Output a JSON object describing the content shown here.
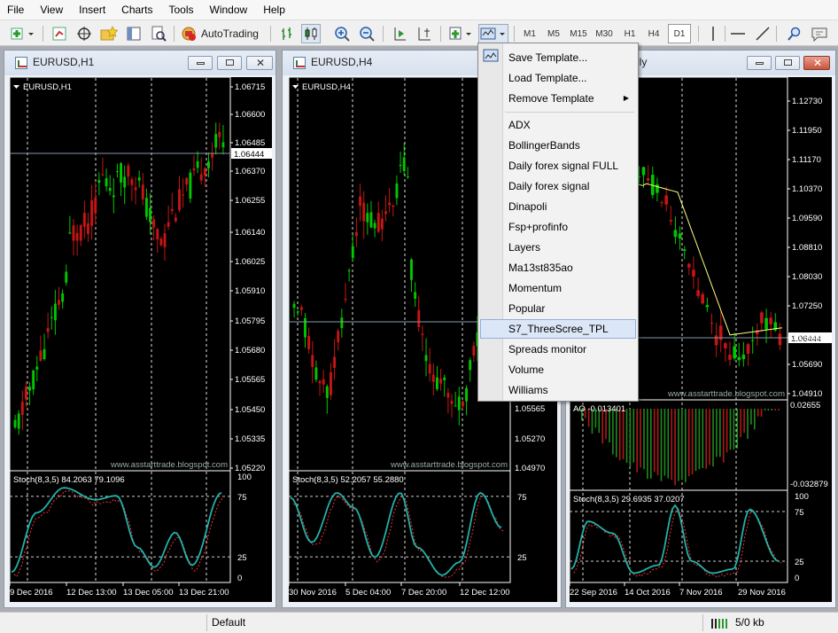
{
  "menu": [
    "File",
    "View",
    "Insert",
    "Charts",
    "Tools",
    "Window",
    "Help"
  ],
  "toolbar": {
    "autotrading_label": "AutoTrading",
    "timeframes": [
      "M1",
      "M5",
      "M15",
      "M30",
      "H1",
      "H4",
      "D1"
    ],
    "active_timeframe": "D1"
  },
  "windows": [
    {
      "title": "EURUSD,H1",
      "symbol_label": "EURUSD,H1",
      "price_labels": [
        "1.06715",
        "1.06600",
        "1.06485",
        "1.06370",
        "1.06255",
        "1.06140",
        "1.06025",
        "1.05910",
        "1.05795",
        "1.05680",
        "1.05565",
        "1.05450",
        "1.05335",
        "1.05220"
      ],
      "current_price": "1.06444",
      "watermark": "www.asstarttrade.blogspot.com",
      "indicator_label": "Stoch(8,3,5) 84.2063 79.1096",
      "indicator_levels": [
        "100",
        "75",
        "25",
        "0"
      ],
      "time_labels": [
        "9 Dec 2016",
        "12 Dec 13:00",
        "13 Dec 05:00",
        "13 Dec 21:00"
      ]
    },
    {
      "title": "EURUSD,H4",
      "symbol_label": "EURUSD,H4",
      "price_labels": [
        "1.05565",
        "1.05270",
        "1.04970"
      ],
      "current_price": "",
      "watermark": "www.asstarttrade.blogspot.com",
      "indicator_label": "Stoch(8,3,5) 52.2057 55.2880",
      "indicator_levels": [
        "75",
        "25"
      ],
      "time_labels": [
        "30 Nov 2016",
        "5 Dec 04:00",
        "7 Dec 20:00",
        "12 Dec 12:00"
      ]
    },
    {
      "title": "ily",
      "symbol_label": "",
      "price_labels": [
        "1.12730",
        "1.11950",
        "1.11170",
        "1.10370",
        "1.09590",
        "1.08810",
        "1.08030",
        "1.07250",
        "1.06444",
        "1.05690",
        "1.04910"
      ],
      "current_price": "1.06444",
      "watermark": "www.asstarttrade.blogspot.com",
      "ao_label": "AO -0.013401",
      "ao_levels": [
        "0.02655",
        "-0.032879"
      ],
      "indicator_label": "Stoch(8,3,5) 29.6935 37.0207",
      "indicator_levels": [
        "100",
        "75",
        "25",
        "0"
      ],
      "time_labels": [
        "22 Sep 2016",
        "14 Oct 2016",
        "7 Nov 2016",
        "29 Nov 2016"
      ]
    }
  ],
  "template_menu": {
    "commands": [
      "Save Template...",
      "Load Template...",
      "Remove Template"
    ],
    "templates": [
      "ADX",
      "BollingerBands",
      "Daily forex signal FULL",
      "Daily forex signal",
      "Dinapoli",
      "Fsp+profinfo",
      "Layers",
      "Ma13st835ao",
      "Momentum",
      "Popular",
      "S7_ThreeScree_TPL",
      "Spreads monitor",
      "Volume",
      "Williams"
    ],
    "highlighted": "S7_ThreeScree_TPL"
  },
  "statusbar": {
    "profile": "Default",
    "connection": "5/0 kb"
  },
  "colors": {
    "bull": "#00c800",
    "bear": "#c81414",
    "stoch_main": "#20b2aa",
    "stoch_signal": "#ff3030",
    "ma": "#ffff80",
    "grid": "#ffffff"
  }
}
